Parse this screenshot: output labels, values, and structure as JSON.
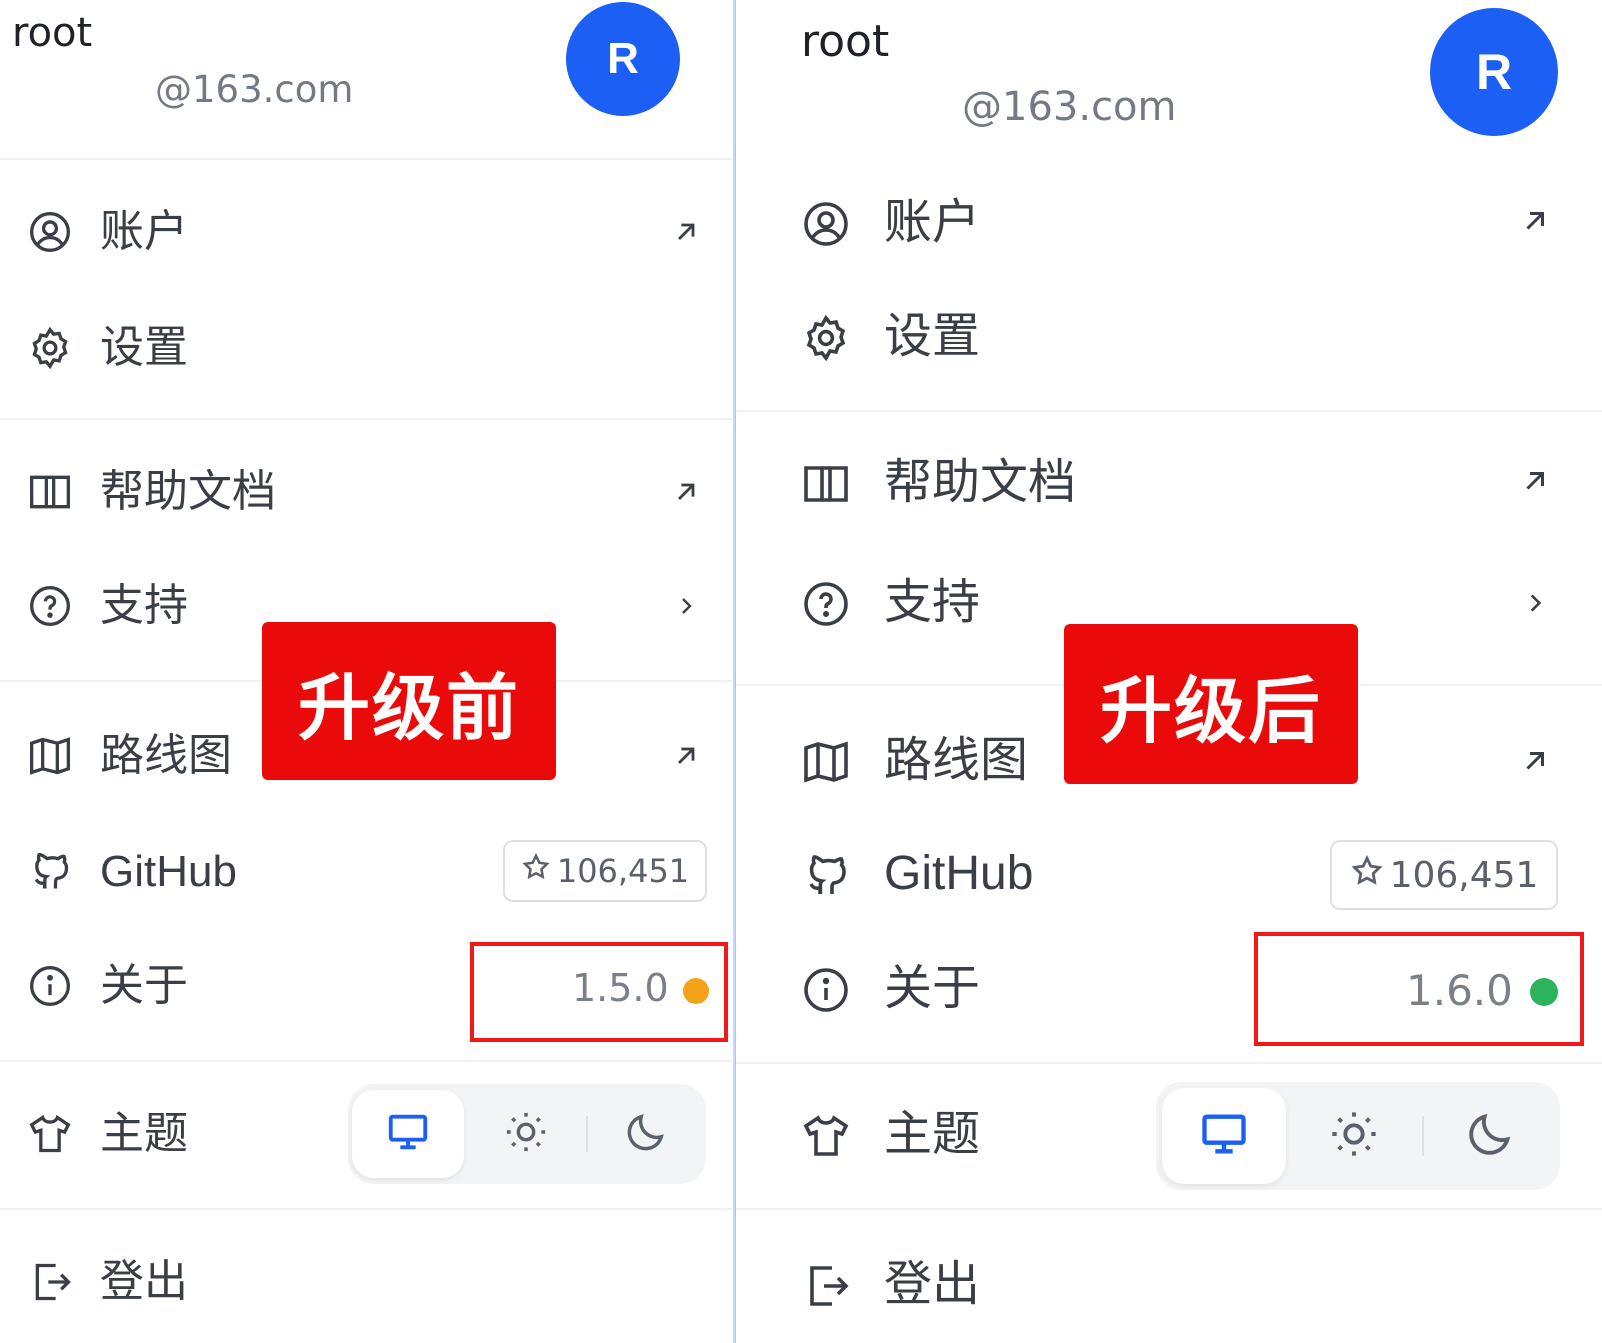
{
  "panels": {
    "left": {
      "profile": {
        "username": "root",
        "email": "@163.com",
        "avatar_letter": "R"
      },
      "menu": {
        "account": "账户",
        "settings": "设置",
        "help_docs": "帮助文档",
        "support": "支持",
        "roadmap": "路线图",
        "github": "GitHub",
        "github_stars": "106,451",
        "about": "关于",
        "version": "1.5.0",
        "theme": "主题",
        "logout": "登出"
      },
      "status_dot_color": "#f5a21b",
      "tag": "升级前"
    },
    "right": {
      "profile": {
        "username": "root",
        "email": "@163.com",
        "avatar_letter": "R"
      },
      "menu": {
        "account": "账户",
        "settings": "设置",
        "help_docs": "帮助文档",
        "support": "支持",
        "roadmap": "路线图",
        "github": "GitHub",
        "github_stars": "106,451",
        "about": "关于",
        "version": "1.6.0",
        "theme": "主题",
        "logout": "登出"
      },
      "status_dot_color": "#2cb35b",
      "tag": "升级后"
    }
  },
  "colors": {
    "avatar": "#1c5ff5",
    "highlight": "#f21818",
    "tag_bg": "#ea0a0a",
    "active_theme_icon": "#1c5ff5"
  },
  "icons": [
    "user-circle-icon",
    "gear-icon",
    "book-icon",
    "question-icon",
    "map-icon",
    "github-icon",
    "info-icon",
    "shirt-icon",
    "logout-icon",
    "external-arrow-icon",
    "chevron-right-icon",
    "star-icon",
    "monitor-icon",
    "sun-icon",
    "moon-icon"
  ]
}
